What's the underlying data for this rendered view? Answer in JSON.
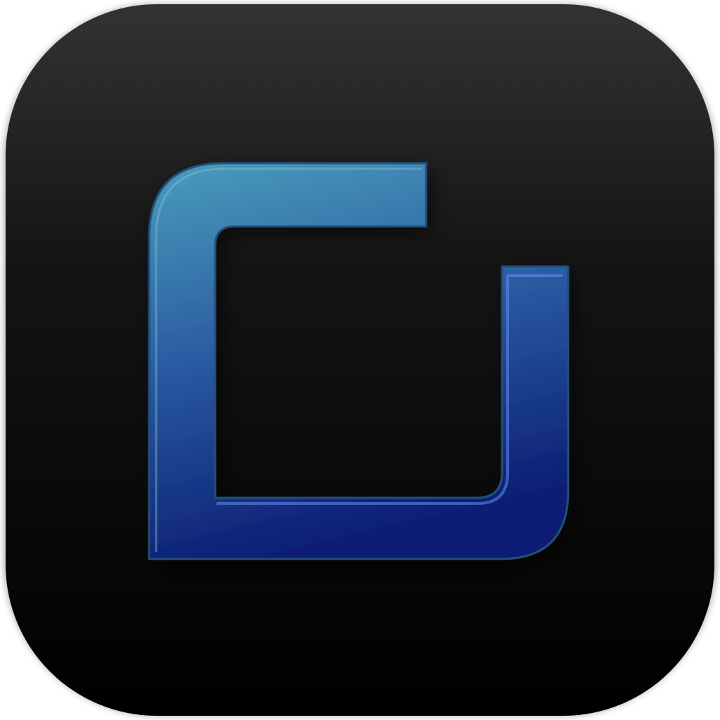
{
  "icon": {
    "name": "bracket-square-app-icon",
    "background_top": "#333333",
    "background_bottom": "#000000",
    "glyph_color_top": "#4a9dbb",
    "glyph_color_bottom": "#0c1f75"
  }
}
